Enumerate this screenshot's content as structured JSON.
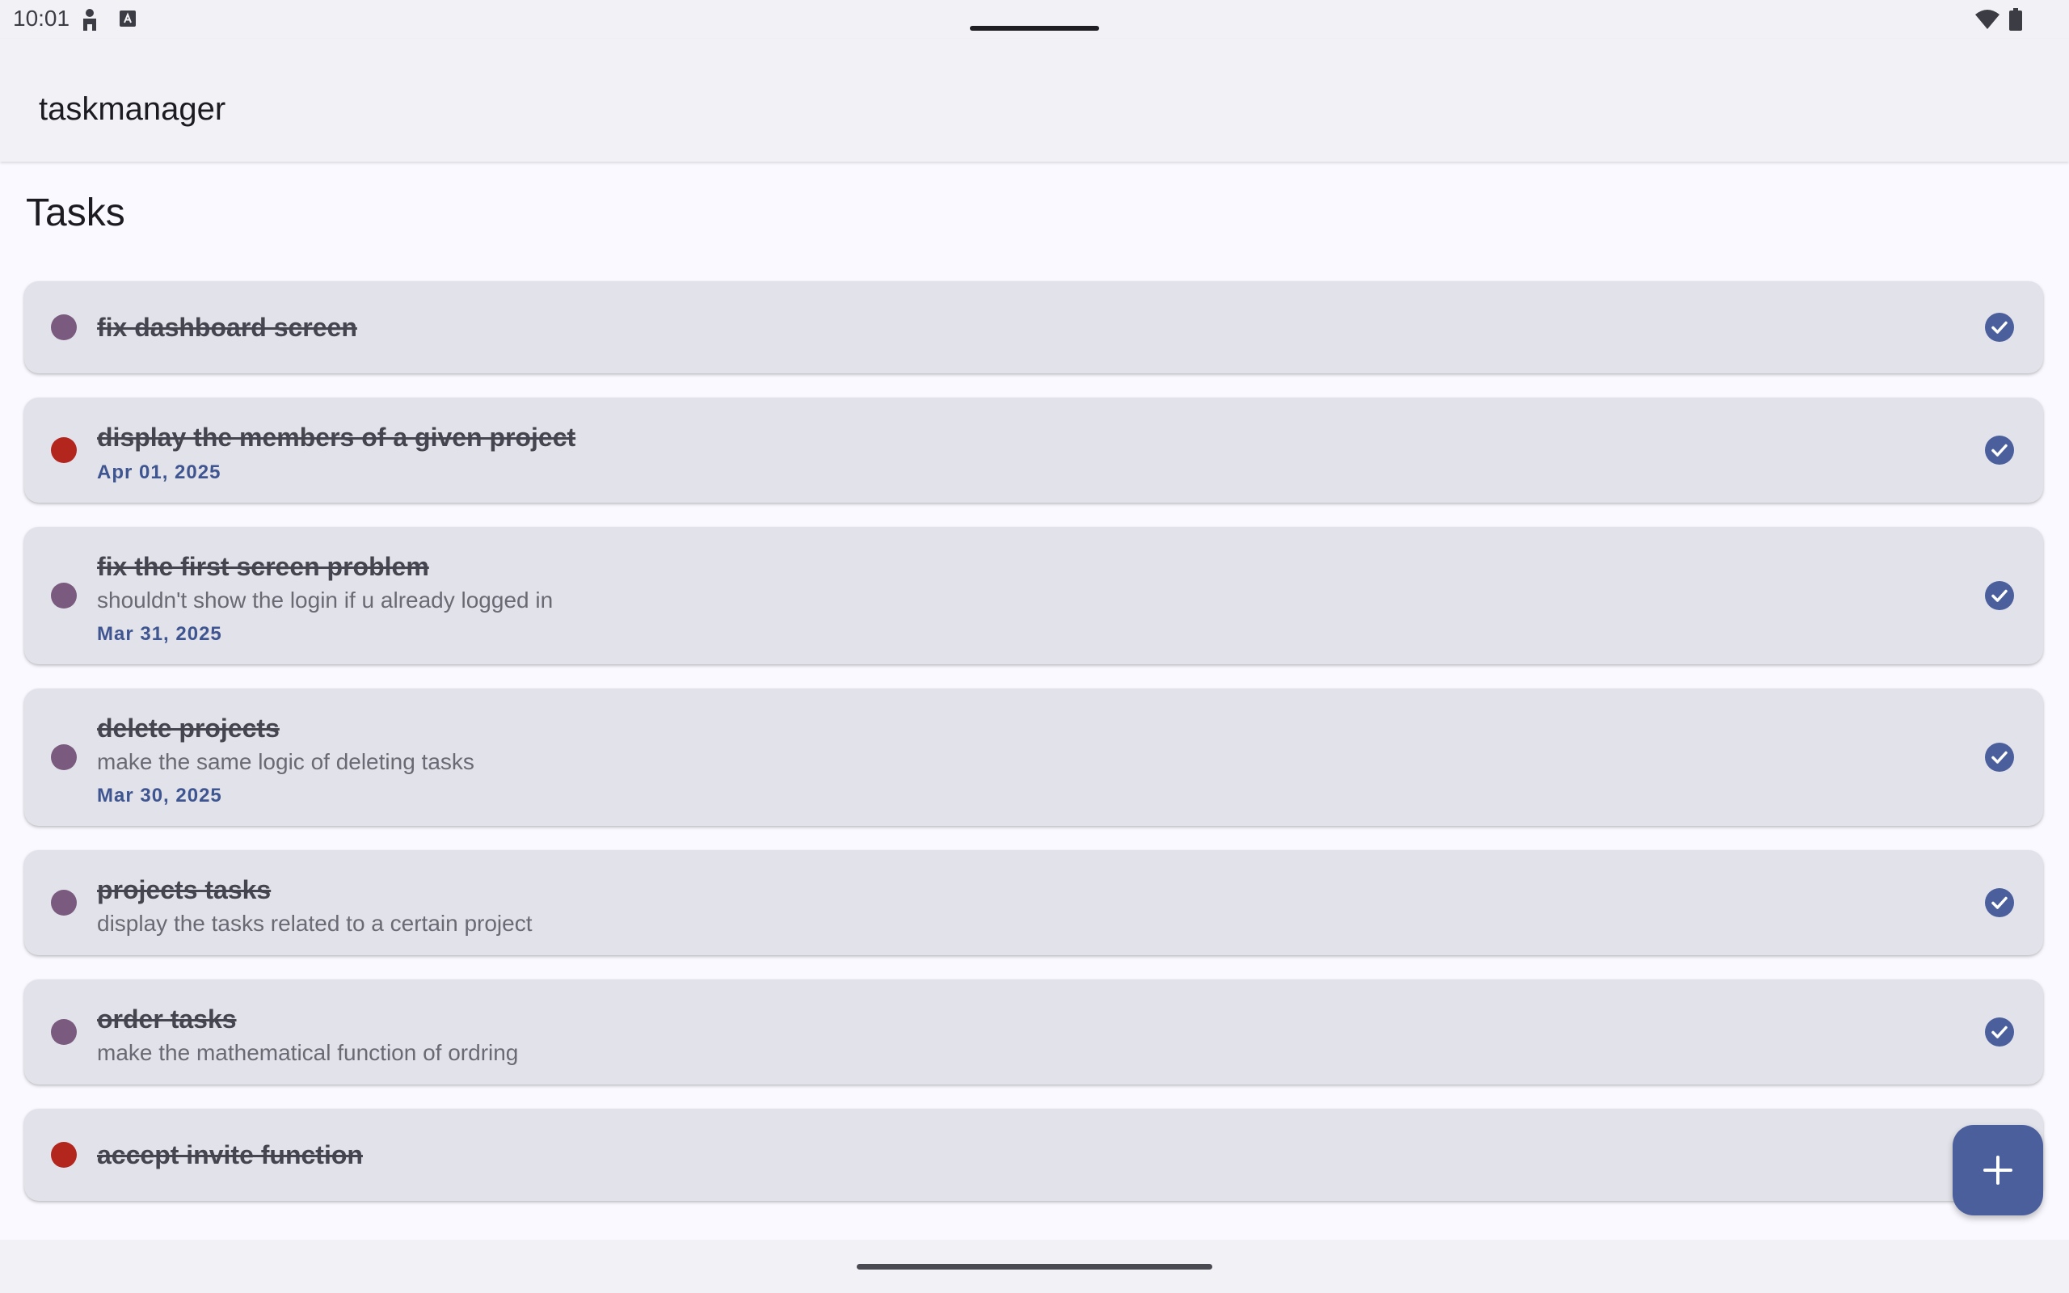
{
  "status_bar": {
    "time": "10:01",
    "left_icons": [
      "person-icon",
      "keyboard-a-icon"
    ],
    "right_icons": [
      "wifi-icon",
      "battery-icon"
    ]
  },
  "app_bar": {
    "title": "taskmanager"
  },
  "page": {
    "title": "Tasks"
  },
  "colors": {
    "accent": "#4a5f9c",
    "priority_normal": "#7a5a7e",
    "priority_high": "#b3261e",
    "card_bg": "#e2e2ea"
  },
  "tasks": [
    {
      "title": "fix dashboard screen",
      "description": "",
      "date": "",
      "priority_color": "#7a5a7e",
      "completed": true
    },
    {
      "title": "display the members of a given project ",
      "description": "",
      "date": "Apr 01, 2025",
      "priority_color": "#b3261e",
      "completed": true
    },
    {
      "title": "fix the first screen problem",
      "description": "shouldn't show the login if u already logged in",
      "date": "Mar 31, 2025",
      "priority_color": "#7a5a7e",
      "completed": true
    },
    {
      "title": "delete projects",
      "description": "make the same logic of deleting tasks",
      "date": "Mar 30, 2025",
      "priority_color": "#7a5a7e",
      "completed": true
    },
    {
      "title": "projects tasks",
      "description": "display the tasks related to a certain project",
      "date": "",
      "priority_color": "#7a5a7e",
      "completed": true
    },
    {
      "title": "order tasks",
      "description": "make the mathematical function of ordring",
      "date": "",
      "priority_color": "#7a5a7e",
      "completed": true
    },
    {
      "title": "accept invite function ",
      "description": "",
      "date": "",
      "priority_color": "#b3261e",
      "completed": true
    }
  ],
  "fab": {
    "icon": "plus-icon"
  }
}
